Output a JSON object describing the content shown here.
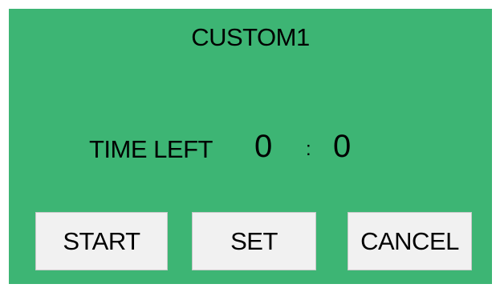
{
  "screen": {
    "title": "CUSTOM1",
    "background_color": "#3db574"
  },
  "timer": {
    "label": "TIME LEFT",
    "minutes": "0",
    "separator": ":",
    "seconds": "0"
  },
  "buttons": {
    "start_label": "START",
    "set_label": "SET",
    "cancel_label": "CANCEL",
    "button_color": "#f1f1f1"
  }
}
